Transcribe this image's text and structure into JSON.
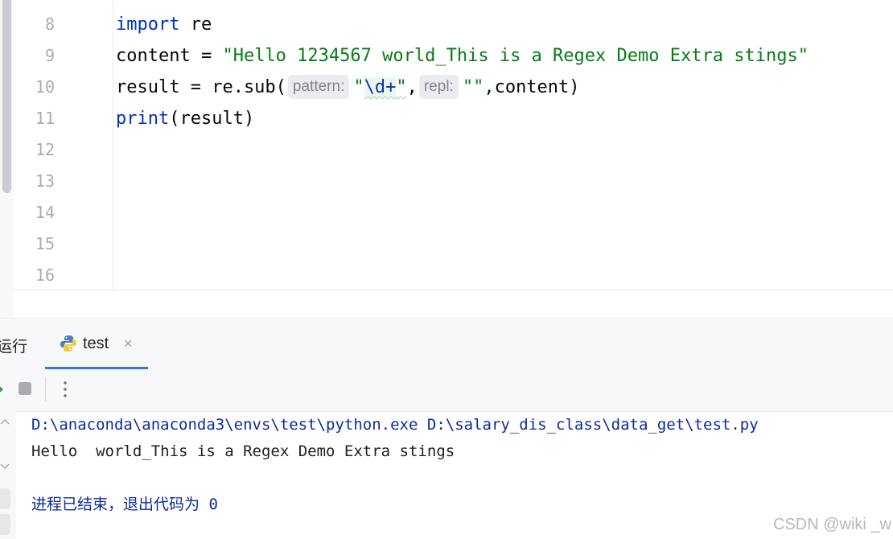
{
  "editor": {
    "line_numbers": [
      "8",
      "9",
      "10",
      "11",
      "12",
      "13",
      "14",
      "15",
      "16"
    ],
    "line1": {
      "kw": "import",
      "rest": " re"
    },
    "line2": {
      "pre": "content = ",
      "str": "\"Hello 1234567 world_This is a Regex Demo Extra stings\""
    },
    "line3": {
      "pre": "result = re.sub(",
      "hint_pattern": "pattern:",
      "q_open": "\"",
      "escape": "\\d+",
      "q_close": "\"",
      "comma": ",",
      "hint_repl": "repl:",
      "empty_str": "\"\"",
      "post": ",content)"
    },
    "line4": {
      "fn": "print",
      "rest": "(result)"
    }
  },
  "run_panel": {
    "label": "运行",
    "tab_label": "test",
    "tab_close": "×",
    "icons": {
      "tab": "python-icon",
      "rerun": "rerun-icon",
      "stop": "stop-icon",
      "more": "more-icon"
    }
  },
  "console": {
    "command": "D:\\anaconda\\anaconda3\\envs\\test\\python.exe D:\\salary_dis_class\\data_get\\test.py",
    "output": "Hello  world_This is a Regex Demo Extra stings",
    "exit": "进程已结束，退出代码为 0"
  },
  "watermark": "CSDN @wiki _w",
  "colors": {
    "keyword": "#0033b3",
    "string": "#067d17",
    "tab_accent": "#3574f0",
    "console_path": "#0b2b9e"
  }
}
